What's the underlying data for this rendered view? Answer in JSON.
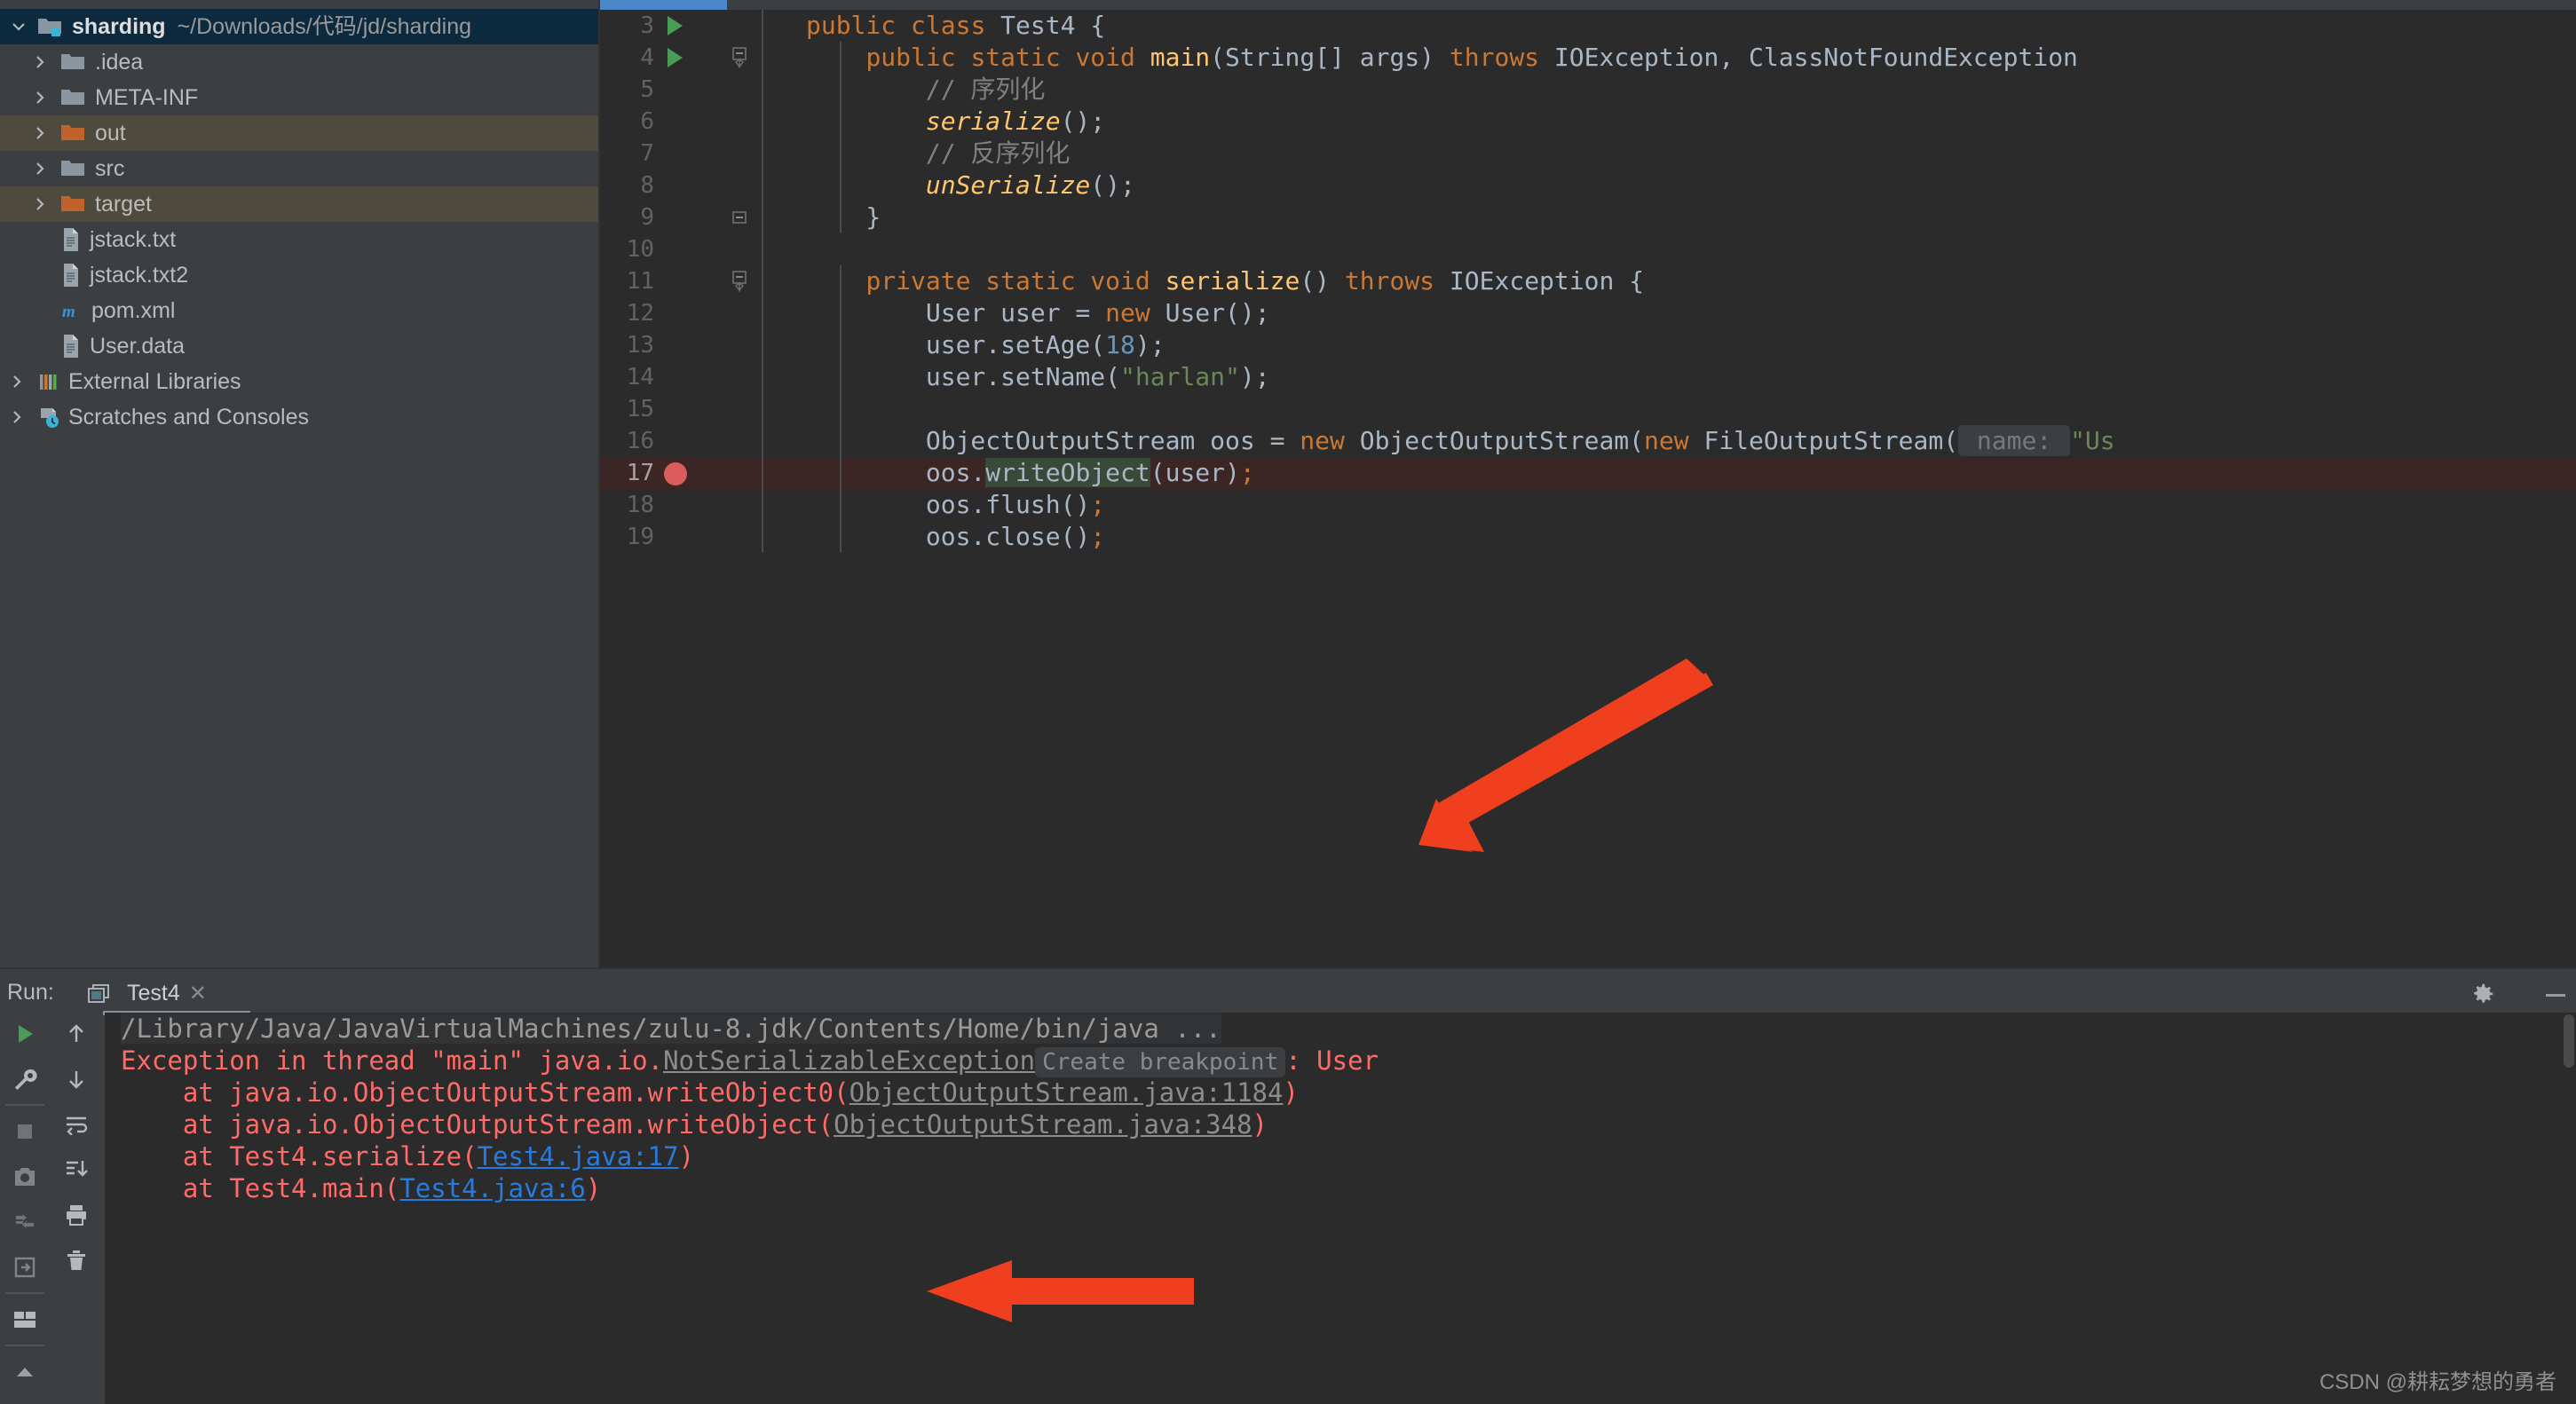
{
  "project": {
    "root": {
      "name": "sharding",
      "path": "~/Downloads/代码/jd/sharding",
      "icon": "module-folder-icon",
      "expanded": true
    },
    "items": [
      {
        "label": ".idea",
        "icon": "folder-icon",
        "kind": "folder",
        "arrow": true,
        "highlight": "none"
      },
      {
        "label": "META-INF",
        "icon": "folder-icon",
        "kind": "folder",
        "arrow": true,
        "highlight": "none"
      },
      {
        "label": "out",
        "icon": "folder-orange-icon",
        "kind": "folder",
        "arrow": true,
        "highlight": "olive"
      },
      {
        "label": "src",
        "icon": "folder-icon",
        "kind": "folder",
        "arrow": true,
        "highlight": "none"
      },
      {
        "label": "target",
        "icon": "folder-orange-icon",
        "kind": "folder",
        "arrow": true,
        "highlight": "olive"
      },
      {
        "label": "jstack.txt",
        "icon": "text-file-icon",
        "kind": "file",
        "arrow": false,
        "highlight": "none"
      },
      {
        "label": "jstack.txt2",
        "icon": "text-file-icon",
        "kind": "file",
        "arrow": false,
        "highlight": "none"
      },
      {
        "label": "pom.xml",
        "icon": "maven-icon",
        "kind": "file",
        "arrow": false,
        "highlight": "none"
      },
      {
        "label": "User.data",
        "icon": "text-file-icon",
        "kind": "file",
        "arrow": false,
        "highlight": "none"
      },
      {
        "label": "External Libraries",
        "icon": "libraries-icon",
        "kind": "node",
        "arrow": true,
        "highlight": "none"
      },
      {
        "label": "Scratches and Consoles",
        "icon": "scratches-icon",
        "kind": "node",
        "arrow": true,
        "highlight": "none"
      }
    ]
  },
  "editor": {
    "file": "Test4.java",
    "lines": [
      {
        "num": "3",
        "runmark": true,
        "fold": false,
        "breakpoint": false,
        "highlight": false,
        "tokens": [
          {
            "t": "public ",
            "c": "kw"
          },
          {
            "t": "class ",
            "c": "kw"
          },
          {
            "t": "Test4 {",
            "c": "id"
          }
        ],
        "indent": 0
      },
      {
        "num": "4",
        "runmark": true,
        "fold": true,
        "breakpoint": false,
        "highlight": false,
        "tokens": [
          {
            "t": "    ",
            "c": "id"
          },
          {
            "t": "public static void ",
            "c": "kw"
          },
          {
            "t": "main",
            "c": "mth"
          },
          {
            "t": "(String[] args) ",
            "c": "id"
          },
          {
            "t": "throws ",
            "c": "kw"
          },
          {
            "t": "IOException, ClassNotFoundException",
            "c": "id"
          }
        ],
        "indent": 1
      },
      {
        "num": "5",
        "runmark": false,
        "fold": false,
        "breakpoint": false,
        "highlight": false,
        "tokens": [
          {
            "t": "        ",
            "c": "id"
          },
          {
            "t": "// 序列化",
            "c": "cmt"
          }
        ],
        "indent": 1
      },
      {
        "num": "6",
        "runmark": false,
        "fold": false,
        "breakpoint": false,
        "highlight": false,
        "tokens": [
          {
            "t": "        ",
            "c": "id"
          },
          {
            "t": "serialize",
            "c": "mth-italic"
          },
          {
            "t": "();",
            "c": "id"
          }
        ],
        "indent": 1
      },
      {
        "num": "7",
        "runmark": false,
        "fold": false,
        "breakpoint": false,
        "highlight": false,
        "tokens": [
          {
            "t": "        ",
            "c": "id"
          },
          {
            "t": "// 反序列化",
            "c": "cmt"
          }
        ],
        "indent": 1
      },
      {
        "num": "8",
        "runmark": false,
        "fold": false,
        "breakpoint": false,
        "highlight": false,
        "tokens": [
          {
            "t": "        ",
            "c": "id"
          },
          {
            "t": "unSerialize",
            "c": "mth-italic"
          },
          {
            "t": "();",
            "c": "id"
          }
        ],
        "indent": 1
      },
      {
        "num": "9",
        "runmark": false,
        "fold": "end",
        "breakpoint": false,
        "highlight": false,
        "tokens": [
          {
            "t": "    }",
            "c": "id"
          }
        ],
        "indent": 1
      },
      {
        "num": "10",
        "runmark": false,
        "fold": false,
        "breakpoint": false,
        "highlight": false,
        "tokens": [],
        "indent": 0
      },
      {
        "num": "11",
        "runmark": false,
        "fold": true,
        "breakpoint": false,
        "highlight": false,
        "tokens": [
          {
            "t": "    ",
            "c": "id"
          },
          {
            "t": "private static void ",
            "c": "kw"
          },
          {
            "t": "serialize",
            "c": "mth"
          },
          {
            "t": "() ",
            "c": "id"
          },
          {
            "t": "throws ",
            "c": "kw"
          },
          {
            "t": "IOException {",
            "c": "id"
          }
        ],
        "indent": 1
      },
      {
        "num": "12",
        "runmark": false,
        "fold": false,
        "breakpoint": false,
        "highlight": false,
        "tokens": [
          {
            "t": "        User user = ",
            "c": "id"
          },
          {
            "t": "new ",
            "c": "kw"
          },
          {
            "t": "User();",
            "c": "id"
          }
        ],
        "indent": 1
      },
      {
        "num": "13",
        "runmark": false,
        "fold": false,
        "breakpoint": false,
        "highlight": false,
        "tokens": [
          {
            "t": "        user.setAge(",
            "c": "id"
          },
          {
            "t": "18",
            "c": "num"
          },
          {
            "t": ");",
            "c": "id"
          }
        ],
        "indent": 1
      },
      {
        "num": "14",
        "runmark": false,
        "fold": false,
        "breakpoint": false,
        "highlight": false,
        "tokens": [
          {
            "t": "        user.setName(",
            "c": "id"
          },
          {
            "t": "\"harlan\"",
            "c": "str"
          },
          {
            "t": ");",
            "c": "id"
          }
        ],
        "indent": 1
      },
      {
        "num": "15",
        "runmark": false,
        "fold": false,
        "breakpoint": false,
        "highlight": false,
        "tokens": [],
        "indent": 1
      },
      {
        "num": "16",
        "runmark": false,
        "fold": false,
        "breakpoint": false,
        "highlight": false,
        "tokens": [
          {
            "t": "        ObjectOutputStream oos = ",
            "c": "id"
          },
          {
            "t": "new ",
            "c": "kw"
          },
          {
            "t": "ObjectOutputStream(",
            "c": "id"
          },
          {
            "t": "new ",
            "c": "kw"
          },
          {
            "t": "FileOutputStream(",
            "c": "id"
          },
          {
            "t": " name: ",
            "c": "hint"
          },
          {
            "t": "\"Us",
            "c": "str"
          }
        ],
        "indent": 1
      },
      {
        "num": "17",
        "runmark": false,
        "fold": false,
        "breakpoint": true,
        "highlight": true,
        "tokens": [
          {
            "t": "        oos.",
            "c": "id"
          },
          {
            "t": "writeObject",
            "c": "sel"
          },
          {
            "t": "(user)",
            "c": "id"
          },
          {
            "t": ";",
            "c": "kw"
          }
        ],
        "indent": 1
      },
      {
        "num": "18",
        "runmark": false,
        "fold": false,
        "breakpoint": false,
        "highlight": false,
        "tokens": [
          {
            "t": "        oos.flush()",
            "c": "id"
          },
          {
            "t": ";",
            "c": "kw"
          }
        ],
        "indent": 1
      },
      {
        "num": "19",
        "runmark": false,
        "fold": false,
        "breakpoint": false,
        "highlight": false,
        "tokens": [
          {
            "t": "        oos.close()",
            "c": "id"
          },
          {
            "t": ";",
            "c": "kw"
          }
        ],
        "indent": 1
      }
    ]
  },
  "run_panel": {
    "label": "Run:",
    "tab_title": "Test4",
    "tab_close": "✕",
    "gear_icon": "gear-icon",
    "minimize_icon": "minimize-icon",
    "left_toolbar": [
      "run-icon",
      "wrench-icon",
      "stop-icon",
      "camera-icon",
      "restart-icon",
      "exit-icon",
      "layout-icon",
      "collapse-icon"
    ],
    "right_toolbar": [
      "arrow-up-icon",
      "arrow-down-icon",
      "soft-wrap-icon",
      "scroll-to-end-icon",
      "print-icon",
      "trash-icon"
    ],
    "console": [
      {
        "kind": "cmd",
        "segments": [
          {
            "t": "/Library/Java/JavaVirtualMachines/zulu-8.jdk/Contents/Home/bin/java ...",
            "c": "c-gray"
          }
        ]
      },
      {
        "kind": "err",
        "segments": [
          {
            "t": "Exception in thread \"main\" java.io.",
            "c": "c-red"
          },
          {
            "t": "NotSerializableException",
            "c": "c-ulink"
          },
          {
            "t": "Create breakpoint",
            "c": "c-chip"
          },
          {
            "t": ": User",
            "c": "c-red"
          }
        ]
      },
      {
        "kind": "err",
        "segments": [
          {
            "t": "    at java.io.ObjectOutputStream.writeObject0(",
            "c": "c-red"
          },
          {
            "t": "ObjectOutputStream.java:1184",
            "c": "c-ulink"
          },
          {
            "t": ")",
            "c": "c-red"
          }
        ]
      },
      {
        "kind": "err",
        "segments": [
          {
            "t": "    at java.io.ObjectOutputStream.writeObject(",
            "c": "c-red"
          },
          {
            "t": "ObjectOutputStream.java:348",
            "c": "c-ulink"
          },
          {
            "t": ")",
            "c": "c-red"
          }
        ]
      },
      {
        "kind": "err",
        "segments": [
          {
            "t": "    at Test4.serialize(",
            "c": "c-red"
          },
          {
            "t": "Test4.java:17",
            "c": "c-blue"
          },
          {
            "t": ")",
            "c": "c-red"
          }
        ]
      },
      {
        "kind": "err",
        "segments": [
          {
            "t": "    at Test4.main(",
            "c": "c-red"
          },
          {
            "t": "Test4.java:6",
            "c": "c-blue"
          },
          {
            "t": ")",
            "c": "c-red"
          }
        ]
      }
    ]
  },
  "annotations": {
    "arrow_color": "#f03f1e",
    "arrow1_name": "annotation-arrow-to-line-17",
    "arrow2_name": "annotation-arrow-to-stacktrace"
  },
  "watermark": "CSDN @耕耘梦想的勇者",
  "colors": {
    "editor_bg": "#2b2b2b",
    "panel_bg": "#3c3f41",
    "selection_blue": "#0d293e",
    "selection_olive": "#4e4a3d",
    "keyword": "#cc7832",
    "string": "#6a8759",
    "number": "#6897bb",
    "method": "#ffc66d",
    "identifier": "#a9b7c6",
    "comment": "#808080",
    "error_red": "#ff6b68",
    "link_blue": "#287bde"
  }
}
